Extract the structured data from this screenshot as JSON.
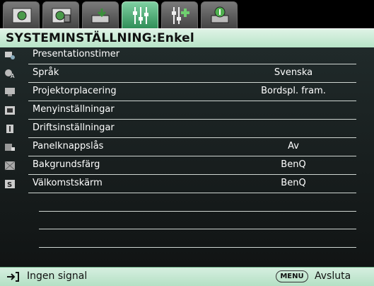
{
  "tabs": [
    {
      "icon": "picture-icon",
      "active": false
    },
    {
      "icon": "picture-advanced-icon",
      "active": false
    },
    {
      "icon": "display-icon",
      "active": false
    },
    {
      "icon": "system-setup-basic-icon",
      "active": true
    },
    {
      "icon": "system-setup-advanced-icon",
      "active": false
    },
    {
      "icon": "information-icon",
      "active": false
    }
  ],
  "header": {
    "title": "SYSTEMINSTÄLLNING:Enkel"
  },
  "menu": {
    "items": [
      {
        "icon": "presentation-timer-icon",
        "label": "Presentationstimer",
        "value": ""
      },
      {
        "icon": "language-icon",
        "label": "Språk",
        "value": "Svenska"
      },
      {
        "icon": "projector-position-icon",
        "label": "Projektorplacering",
        "value": "Bordspl. fram."
      },
      {
        "icon": "menu-settings-icon",
        "label": "Menyinställningar",
        "value": ""
      },
      {
        "icon": "operation-settings-icon",
        "label": "Driftsinställningar",
        "value": ""
      },
      {
        "icon": "panel-key-lock-icon",
        "label": "Panelknappslås",
        "value": "Av"
      },
      {
        "icon": "background-color-icon",
        "label": "Bakgrundsfärg",
        "value": "BenQ"
      },
      {
        "icon": "splash-screen-icon",
        "label": "Välkomstskärm",
        "value": "BenQ"
      }
    ]
  },
  "footer": {
    "signal_icon": "input-source-icon",
    "signal_text": "Ingen signal",
    "menu_key": "MENU",
    "exit_label": "Avsluta"
  },
  "colors": {
    "accent": "#2e8d56",
    "header_bg": "#c8ecd5",
    "body_bg": "#1a1f1f"
  }
}
